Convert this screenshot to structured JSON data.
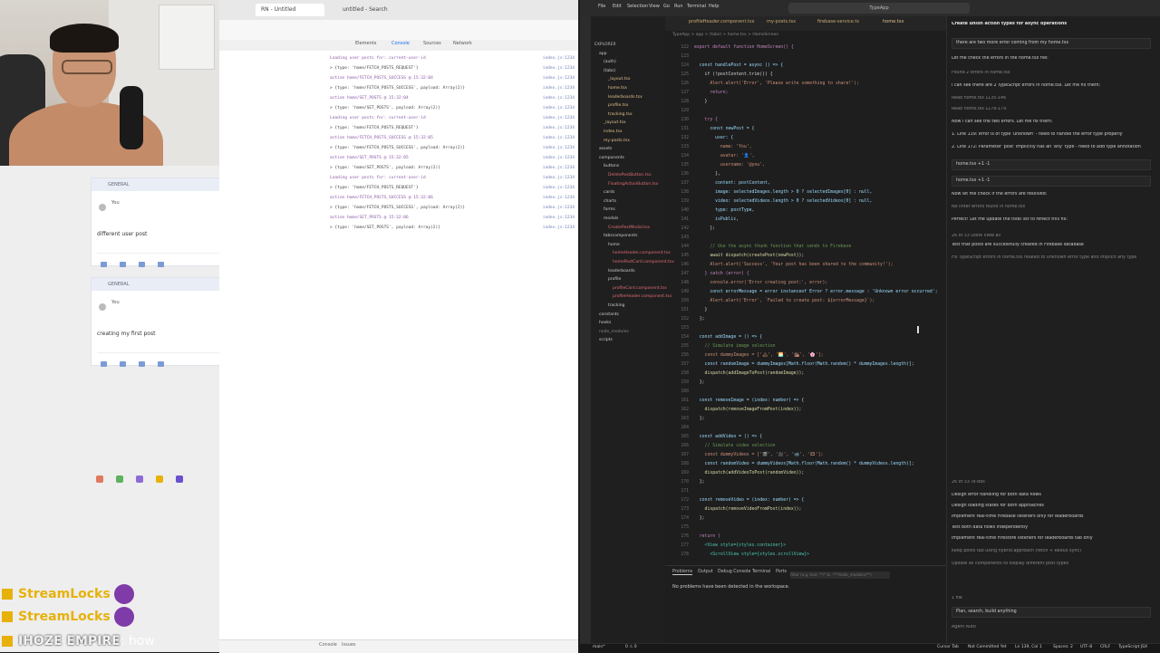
{
  "browser": {
    "tabs": [
      "RN - Untitled",
      "untitled - Search"
    ],
    "devtools_tabs": [
      "Elements",
      "Console",
      "Sources",
      "Network"
    ],
    "console_footer": [
      "Console",
      "Issues"
    ]
  },
  "app_preview": {
    "cards": [
      {
        "header": "GENERAL",
        "user": "You",
        "text": "different user post"
      },
      {
        "header": "GENERAL",
        "user": "You",
        "text": "creating my first post"
      }
    ],
    "bottom_nav_colors": [
      "#e07a5f",
      "#5db15f",
      "#8f6ad6",
      "#e7b10a",
      "#6a4fcf"
    ]
  },
  "console_logs": [
    {
      "text": "Loading user posts for: current-user-id",
      "kind": "text",
      "src": "index.js:1234"
    },
    {
      "text": "> {type: 'home/FETCH_POSTS_REQUEST'}",
      "kind": "sub",
      "src": "index.js:1234"
    },
    {
      "text": "action home/FETCH_POSTS_SUCCESS @ 15:32:04",
      "kind": "text",
      "src": "index.js:1234"
    },
    {
      "text": "> {type: 'home/FETCH_POSTS_SUCCESS', payload: Array(2)}",
      "kind": "sub",
      "src": "index.js:1234"
    },
    {
      "text": "action home/SET_POSTS @ 15:32:04",
      "kind": "text",
      "src": "index.js:1234"
    },
    {
      "text": "> {type: 'home/SET_POSTS', payload: Array(2)}",
      "kind": "sub",
      "src": "index.js:1234"
    },
    {
      "text": "Loading user posts for: current-user-id",
      "kind": "text",
      "src": "index.js:1234"
    },
    {
      "text": "> {type: 'home/FETCH_POSTS_REQUEST'}",
      "kind": "sub",
      "src": "index.js:1234"
    },
    {
      "text": "action home/FETCH_POSTS_SUCCESS @ 15:32:05",
      "kind": "text",
      "src": "index.js:1234"
    },
    {
      "text": "> {type: 'home/FETCH_POSTS_SUCCESS', payload: Array(2)}",
      "kind": "sub",
      "src": "index.js:1234"
    },
    {
      "text": "action home/SET_POSTS @ 15:32:05",
      "kind": "text",
      "src": "index.js:1234"
    },
    {
      "text": "> {type: 'home/SET_POSTS', payload: Array(2)}",
      "kind": "sub",
      "src": "index.js:1234"
    },
    {
      "text": "Loading user posts for: current-user-id",
      "kind": "text",
      "src": "index.js:1234"
    },
    {
      "text": "> {type: 'home/FETCH_POSTS_REQUEST'}",
      "kind": "sub",
      "src": "index.js:1234"
    },
    {
      "text": "action home/FETCH_POSTS_SUCCESS @ 15:32:06",
      "kind": "text",
      "src": "index.js:1234"
    },
    {
      "text": "> {type: 'home/FETCH_POSTS_SUCCESS', payload: Array(2)}",
      "kind": "sub",
      "src": "index.js:1234"
    },
    {
      "text": "action home/SET_POSTS @ 15:32:06",
      "kind": "text",
      "src": "index.js:1234"
    },
    {
      "text": "> {type: 'home/SET_POSTS', payload: Array(2)}",
      "kind": "sub",
      "src": "index.js:1234"
    }
  ],
  "stream_chat": [
    {
      "name": "StreamLocks",
      "message": "",
      "color": "yellow",
      "emote": true
    },
    {
      "name": "StreamLocks",
      "message": "",
      "color": "yellow",
      "emote": true
    },
    {
      "name": "IHOZE EMPIRE",
      "message": ": how",
      "color": "white",
      "emote": false
    }
  ],
  "vscode": {
    "title_search": "TypeApp",
    "menu": [
      "File",
      "Edit",
      "Selection",
      "View",
      "Go",
      "Run",
      "Terminal",
      "Help"
    ],
    "editor_tabs": [
      "profileHeader.component.tsx",
      "my-posts.tsx",
      "firebase-service.ts",
      "home.tsx"
    ],
    "breadcrumb": "TypeApp > app > (tabs) > home.tsx > HomeScreen",
    "explorer": [
      {
        "name": "EXPLORER",
        "indent": 0,
        "color": "#bbbbbb"
      },
      {
        "name": "app",
        "indent": 1,
        "color": "#cccccc"
      },
      {
        "name": "(auth)",
        "indent": 2,
        "color": "#cccccc"
      },
      {
        "name": "(tabs)",
        "indent": 2,
        "color": "#cccccc"
      },
      {
        "name": "_layout.tsx",
        "indent": 3,
        "color": "#e2c08d"
      },
      {
        "name": "home.tsx",
        "indent": 3,
        "color": "#e2c08d"
      },
      {
        "name": "leaderboards.tsx",
        "indent": 3,
        "color": "#e2c08d"
      },
      {
        "name": "profile.tsx",
        "indent": 3,
        "color": "#e2c08d"
      },
      {
        "name": "tracking.tsx",
        "indent": 3,
        "color": "#e2c08d"
      },
      {
        "name": "_layout.tsx",
        "indent": 2,
        "color": "#e2c08d"
      },
      {
        "name": "index.tsx",
        "indent": 2,
        "color": "#e2c08d"
      },
      {
        "name": "my-posts.tsx",
        "indent": 2,
        "color": "#e2c08d"
      },
      {
        "name": "assets",
        "indent": 1,
        "color": "#cccccc"
      },
      {
        "name": "components",
        "indent": 1,
        "color": "#cccccc"
      },
      {
        "name": "buttons",
        "indent": 2,
        "color": "#cccccc"
      },
      {
        "name": "DeletePostButton.tsx",
        "indent": 3,
        "color": "#e06c75"
      },
      {
        "name": "FloatingActionButton.tsx",
        "indent": 3,
        "color": "#e06c75"
      },
      {
        "name": "cards",
        "indent": 2,
        "color": "#cccccc"
      },
      {
        "name": "charts",
        "indent": 2,
        "color": "#cccccc"
      },
      {
        "name": "forms",
        "indent": 2,
        "color": "#cccccc"
      },
      {
        "name": "modals",
        "indent": 2,
        "color": "#cccccc"
      },
      {
        "name": "CreatePostModal.tsx",
        "indent": 3,
        "color": "#e06c75"
      },
      {
        "name": "tabscomponents",
        "indent": 2,
        "color": "#cccccc"
      },
      {
        "name": "home",
        "indent": 3,
        "color": "#cccccc"
      },
      {
        "name": "homeHeader.component.tsx",
        "indent": 4,
        "color": "#e06c75"
      },
      {
        "name": "homePostCard.component.tsx",
        "indent": 4,
        "color": "#e06c75"
      },
      {
        "name": "leaderboards",
        "indent": 3,
        "color": "#cccccc"
      },
      {
        "name": "profile",
        "indent": 3,
        "color": "#cccccc"
      },
      {
        "name": "profileCard.component.tsx",
        "indent": 4,
        "color": "#e06c75"
      },
      {
        "name": "profileHeader.component.tsx",
        "indent": 4,
        "color": "#e06c75"
      },
      {
        "name": "tracking",
        "indent": 3,
        "color": "#cccccc"
      },
      {
        "name": "constants",
        "indent": 1,
        "color": "#cccccc"
      },
      {
        "name": "hooks",
        "indent": 1,
        "color": "#cccccc"
      },
      {
        "name": "node_modules",
        "indent": 1,
        "color": "#888888"
      },
      {
        "name": "scripts",
        "indent": 1,
        "color": "#cccccc"
      }
    ],
    "code_lines": [
      {
        "n": "122",
        "t": "export default function HomeScreen() {",
        "c": "#c586c0"
      },
      {
        "n": "123",
        "t": "",
        "c": "#d4d4d4"
      },
      {
        "n": "124",
        "t": "  const handlePost = async () => {",
        "c": "#9cdcfe"
      },
      {
        "n": "125",
        "t": "    if (!postContent.trim()) {",
        "c": "#d4d4d4"
      },
      {
        "n": "126",
        "t": "      Alert.alert('Error', 'Please write something to share!');",
        "c": "#ce9178"
      },
      {
        "n": "127",
        "t": "      return;",
        "c": "#c586c0"
      },
      {
        "n": "128",
        "t": "    }",
        "c": "#d4d4d4"
      },
      {
        "n": "129",
        "t": "",
        "c": "#d4d4d4"
      },
      {
        "n": "130",
        "t": "    try {",
        "c": "#c586c0"
      },
      {
        "n": "131",
        "t": "      const newPost = {",
        "c": "#9cdcfe"
      },
      {
        "n": "132",
        "t": "        user: {",
        "c": "#9cdcfe"
      },
      {
        "n": "133",
        "t": "          name: 'You',",
        "c": "#ce9178"
      },
      {
        "n": "134",
        "t": "          avatar: '👤',",
        "c": "#ce9178"
      },
      {
        "n": "135",
        "t": "          username: '@you',",
        "c": "#ce9178"
      },
      {
        "n": "136",
        "t": "        },",
        "c": "#d4d4d4"
      },
      {
        "n": "137",
        "t": "        content: postContent,",
        "c": "#9cdcfe"
      },
      {
        "n": "138",
        "t": "        image: selectedImages.length > 0 ? selectedImages[0] : null,",
        "c": "#9cdcfe"
      },
      {
        "n": "139",
        "t": "        video: selectedVideos.length > 0 ? selectedVideos[0] : null,",
        "c": "#9cdcfe"
      },
      {
        "n": "140",
        "t": "        type: postType,",
        "c": "#9cdcfe"
      },
      {
        "n": "141",
        "t": "        isPublic,",
        "c": "#9cdcfe"
      },
      {
        "n": "142",
        "t": "      };",
        "c": "#d4d4d4"
      },
      {
        "n": "143",
        "t": "",
        "c": "#d4d4d4"
      },
      {
        "n": "144",
        "t": "      // Use the async thunk function that sends to Firebase",
        "c": "#6a9955"
      },
      {
        "n": "145",
        "t": "      await dispatch(createPost(newPost));",
        "c": "#dcdcaa"
      },
      {
        "n": "146",
        "t": "      Alert.alert('Success', 'Your post has been shared to the community!');",
        "c": "#ce9178"
      },
      {
        "n": "147",
        "t": "    } catch (error) {",
        "c": "#c586c0"
      },
      {
        "n": "148",
        "t": "      console.error('Error creating post:', error);",
        "c": "#ce9178"
      },
      {
        "n": "149",
        "t": "      const errorMessage = error instanceof Error ? error.message : 'Unknown error occurred';",
        "c": "#9cdcfe"
      },
      {
        "n": "150",
        "t": "      Alert.alert('Error', `Failed to create post: ${errorMessage}`);",
        "c": "#ce9178"
      },
      {
        "n": "151",
        "t": "    }",
        "c": "#d4d4d4"
      },
      {
        "n": "152",
        "t": "  };",
        "c": "#d4d4d4"
      },
      {
        "n": "153",
        "t": "",
        "c": "#d4d4d4"
      },
      {
        "n": "154",
        "t": "  const addImage = () => {",
        "c": "#9cdcfe"
      },
      {
        "n": "155",
        "t": "    // Simulate image selection",
        "c": "#6a9955"
      },
      {
        "n": "156",
        "t": "    const dummyImages = ['🏔', '🌅', '🏙', '🌸'];",
        "c": "#ce9178"
      },
      {
        "n": "157",
        "t": "    const randomImage = dummyImages[Math.floor(Math.random() * dummyImages.length)];",
        "c": "#9cdcfe"
      },
      {
        "n": "158",
        "t": "    dispatch(addImageToPost(randomImage));",
        "c": "#dcdcaa"
      },
      {
        "n": "159",
        "t": "  };",
        "c": "#d4d4d4"
      },
      {
        "n": "160",
        "t": "",
        "c": "#d4d4d4"
      },
      {
        "n": "161",
        "t": "  const removeImage = (index: number) => {",
        "c": "#9cdcfe"
      },
      {
        "n": "162",
        "t": "    dispatch(removeImageFromPost(index));",
        "c": "#dcdcaa"
      },
      {
        "n": "163",
        "t": "  };",
        "c": "#d4d4d4"
      },
      {
        "n": "164",
        "t": "",
        "c": "#d4d4d4"
      },
      {
        "n": "165",
        "t": "  const addVideo = () => {",
        "c": "#9cdcfe"
      },
      {
        "n": "166",
        "t": "    // Simulate video selection",
        "c": "#6a9955"
      },
      {
        "n": "167",
        "t": "    const dummyVideos = ['🎬', '🎥', '📹', '🎞'];",
        "c": "#ce9178"
      },
      {
        "n": "168",
        "t": "    const randomVideo = dummyVideos[Math.floor(Math.random() * dummyVideos.length)];",
        "c": "#9cdcfe"
      },
      {
        "n": "169",
        "t": "    dispatch(addVideoToPost(randomVideo));",
        "c": "#dcdcaa"
      },
      {
        "n": "170",
        "t": "  };",
        "c": "#d4d4d4"
      },
      {
        "n": "171",
        "t": "",
        "c": "#d4d4d4"
      },
      {
        "n": "172",
        "t": "  const removeVideo = (index: number) => {",
        "c": "#9cdcfe"
      },
      {
        "n": "173",
        "t": "    dispatch(removeVideoFromPost(index));",
        "c": "#dcdcaa"
      },
      {
        "n": "174",
        "t": "  };",
        "c": "#d4d4d4"
      },
      {
        "n": "175",
        "t": "",
        "c": "#d4d4d4"
      },
      {
        "n": "176",
        "t": "  return (",
        "c": "#c586c0"
      },
      {
        "n": "177",
        "t": "    <View style={styles.container}>",
        "c": "#4ec9b0"
      },
      {
        "n": "178",
        "t": "      <ScrollView style={styles.scrollView}>",
        "c": "#4ec9b0"
      }
    ],
    "panel_tabs": [
      "Problems",
      "Output",
      "Debug Console",
      "Terminal",
      "Ports"
    ],
    "panel_filter": "Filter (e.g. text, **/*.ts, !**/node_modules/**)",
    "panel_message": "No problems have been detected in the workspace.",
    "chat": [
      {
        "t": "Create union action types for async operations",
        "s": "title"
      },
      {
        "t": "there are two more error coming from my home.tsx",
        "s": "box"
      },
      {
        "t": "Let me check the errors in the home.tsx file:",
        "s": "normal"
      },
      {
        "t": "Found 2 errors in home.tsx",
        "s": "dim"
      },
      {
        "t": "I can see there are 2 TypeScript errors in home.tsx. Let me fix them:",
        "s": "normal"
      },
      {
        "t": "Read home.tsx L135-146",
        "s": "dim"
      },
      {
        "t": "Read home.tsx L178-179",
        "s": "dim"
      },
      {
        "t": "Now I can see the two errors. Let me fix them:",
        "s": "normal"
      },
      {
        "t": "1. Line 139: error is of type 'unknown' - need to handle the error type properly",
        "s": "normal"
      },
      {
        "t": "2. Line 172: Parameter 'post' implicitly has an 'any' type - need to add type annotation",
        "s": "normal"
      },
      {
        "t": "home.tsx +1 -1",
        "s": "box"
      },
      {
        "t": "home.tsx +1 -1",
        "s": "box"
      },
      {
        "t": "Now let me check if the errors are resolved:",
        "s": "normal"
      },
      {
        "t": "No linter errors found in home.tsx",
        "s": "dim"
      },
      {
        "t": "Perfect! Let me update the todo list to reflect this fix:",
        "s": "normal"
      },
      {
        "t": "26 of 33 Done  View all",
        "s": "dim"
      },
      {
        "t": "Test that posts are successfully created in Firebase database",
        "s": "normal"
      },
      {
        "t": "Fix TypeScript errors in home.tsx related to unknown error type and implicit any type",
        "s": "dim"
      },
      {
        "t": "26 of 33 To-dos",
        "s": "dim"
      },
      {
        "t": "Design error handling for both data flows",
        "s": "normal"
      },
      {
        "t": "Design loading states for both approaches",
        "s": "normal"
      },
      {
        "t": "Implement real-time Firebase listeners only for leaderboards",
        "s": "normal"
      },
      {
        "t": "Test both data flows independently",
        "s": "normal"
      },
      {
        "t": "Implement real-time Firestore listeners for leaderboards tab only",
        "s": "normal"
      },
      {
        "t": "Keep posts tab using hybrid approach (fetch + Redux sync)",
        "s": "dim"
      },
      {
        "t": "Update all components to display different post types",
        "s": "dim"
      },
      {
        "t": "1 file",
        "s": "dim"
      },
      {
        "t": "Plan, search, build anything",
        "s": "box"
      },
      {
        "t": "Agent  Auto",
        "s": "dim"
      }
    ],
    "status": [
      "main*",
      "0 ⚠ 0",
      "Cursor Tab",
      "Not Committed Yet",
      "Ln 139, Col 1",
      "Spaces: 2",
      "UTF-8",
      "CRLF",
      "TypeScript JSX"
    ]
  }
}
